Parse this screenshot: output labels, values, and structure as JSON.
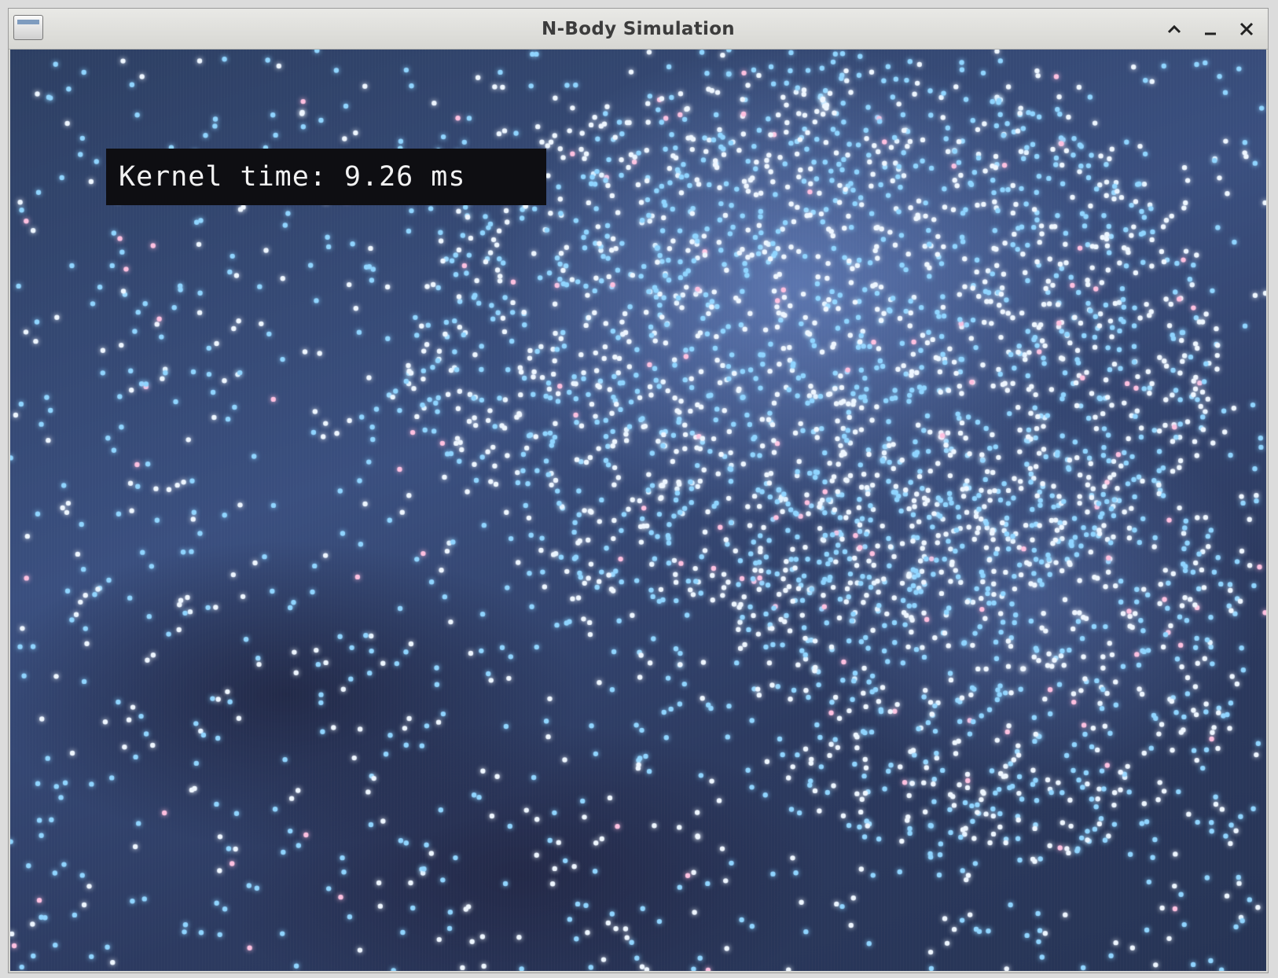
{
  "window": {
    "title": "N-Body Simulation",
    "controls": {
      "maximize": "chevron-up-icon",
      "minimize": "minimize-icon",
      "close": "close-icon"
    }
  },
  "overlay": {
    "kernel_time": "Kernel time: 9.26 ms"
  },
  "colors": {
    "particle_blue": "#8fd4ff",
    "particle_white": "#eef6ff",
    "particle_pink": "#ffc0e0",
    "background": "#3a4f7f"
  }
}
